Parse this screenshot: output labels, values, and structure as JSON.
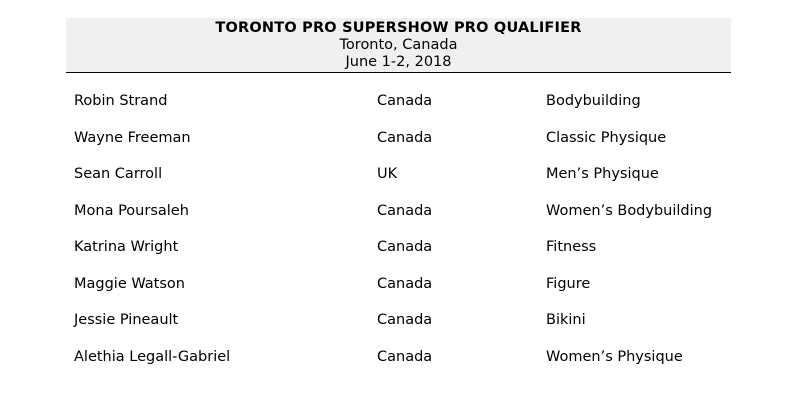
{
  "header": {
    "title": "TORONTO PRO SUPERSHOW PRO QUALIFIER",
    "location": "Toronto, Canada",
    "date": "June 1-2, 2018"
  },
  "results": [
    {
      "name": "Robin Strand",
      "country": "Canada",
      "division": "Bodybuilding"
    },
    {
      "name": "Wayne Freeman",
      "country": "Canada",
      "division": "Classic Physique"
    },
    {
      "name": "Sean Carroll",
      "country": "UK",
      "division": "Men’s Physique"
    },
    {
      "name": "Mona Poursaleh",
      "country": "Canada",
      "division": "Women’s Bodybuilding"
    },
    {
      "name": "Katrina Wright",
      "country": "Canada",
      "division": "Fitness"
    },
    {
      "name": "Maggie Watson",
      "country": "Canada",
      "division": "Figure"
    },
    {
      "name": "Jessie Pineault",
      "country": "Canada",
      "division": "Bikini"
    },
    {
      "name": "Alethia Legall-Gabriel",
      "country": "Canada",
      "division": "Women’s Physique"
    }
  ]
}
